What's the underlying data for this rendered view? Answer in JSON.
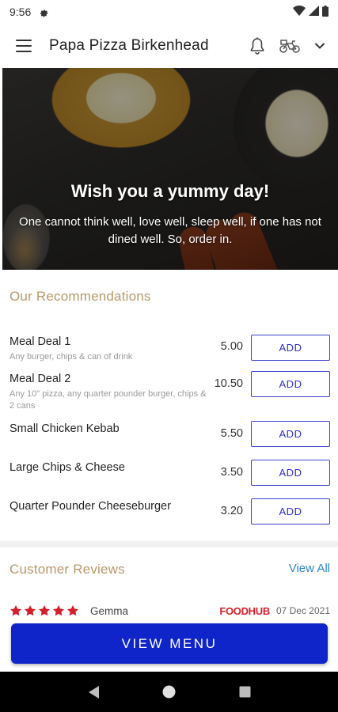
{
  "status_bar": {
    "time": "9:56"
  },
  "app_bar": {
    "title": "Papa Pizza Birkenhead"
  },
  "hero": {
    "title": "Wish you a yummy day!",
    "subtitle": "One cannot think well, love well, sleep well, if one has not dined well. So, order in."
  },
  "recommendations": {
    "title": "Our Recommendations",
    "add_label": "ADD",
    "items": [
      {
        "name": "Meal Deal 1",
        "description": "Any burger, chips & can of drink",
        "price": "5.00"
      },
      {
        "name": "Meal Deal 2",
        "description": "Any 10\" pizza, any quarter pounder burger, chips & 2 cans",
        "price": "10.50"
      },
      {
        "name": "Small Chicken Kebab",
        "description": "",
        "price": "5.50"
      },
      {
        "name": "Large Chips & Cheese",
        "description": "",
        "price": "3.50"
      },
      {
        "name": "Quarter Pounder Cheeseburger",
        "description": "",
        "price": "3.20"
      }
    ]
  },
  "reviews": {
    "title": "Customer Reviews",
    "view_all": "View All",
    "items": [
      {
        "rating": 5,
        "reviewer": "Gemma",
        "source": "FOODHUB",
        "date": "07 Dec 2021"
      }
    ]
  },
  "cta": {
    "label": "VIEW MENU"
  },
  "colors": {
    "accent_button": "#0f24c9",
    "add_border": "#3a3fd0",
    "section_title": "#b8986a",
    "link": "#2a86c9",
    "star": "#d4202a",
    "brand_source": "#d4202a"
  },
  "icons": {
    "status": [
      "gear-icon",
      "wifi-icon",
      "signal-icon",
      "battery-icon"
    ],
    "app_bar": [
      "menu-icon",
      "bell-icon",
      "delivery-bike-icon",
      "chevron-down-icon"
    ],
    "nav": [
      "back-icon",
      "home-icon",
      "recents-icon"
    ]
  }
}
